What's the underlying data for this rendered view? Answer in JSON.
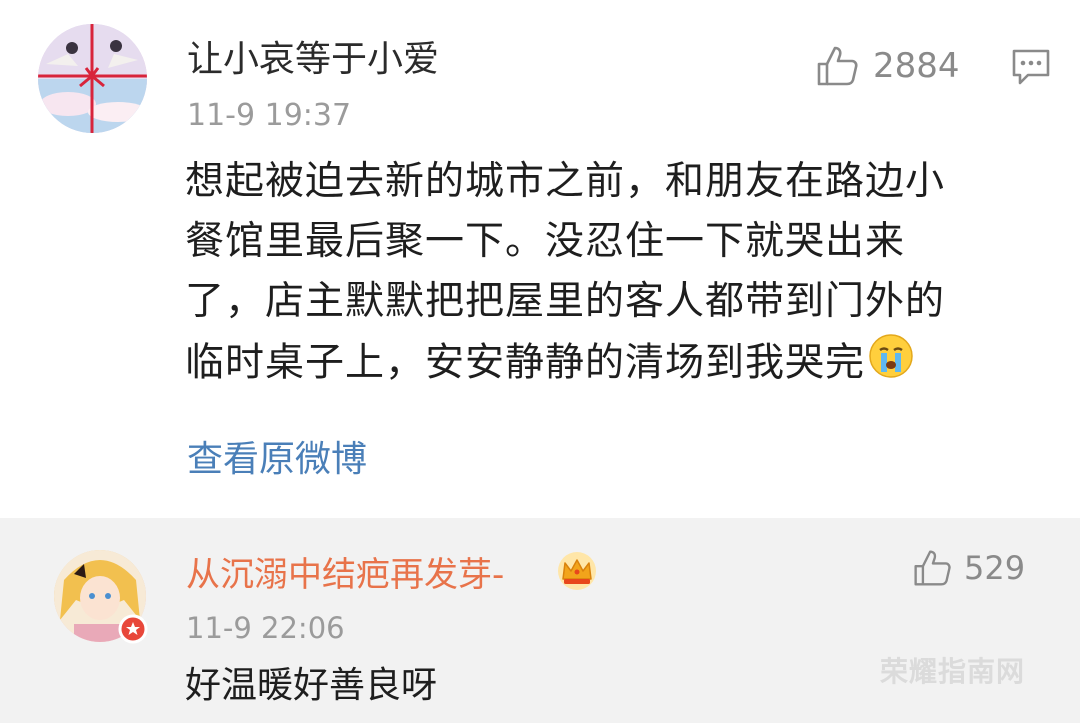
{
  "main_comment": {
    "username": "让小哀等于小爱",
    "timestamp": "11-9 19:37",
    "like_count": "2884",
    "body_lines": [
      "想起被迫去新的城市之前，和朋友在路边小",
      "餐馆里最后聚一下。没忍住一下就哭出来",
      "了，店主默默把把屋里的客人都带到门外的",
      "临时桌子上，安安静静的清场到我哭完"
    ],
    "view_original": "查看原微博"
  },
  "reply_comment": {
    "username": "从沉溺中结疤再发芽-",
    "timestamp": "11-9 22:06",
    "like_count": "529",
    "text": "好温暖好善良呀"
  },
  "watermark": "荣耀指南网",
  "icons": {
    "like": "thumbs-up-icon",
    "reply": "comment-bubble-icon",
    "emoji": "crying-face-icon",
    "crown": "crown-icon",
    "badge": "verified-badge-icon"
  },
  "colors": {
    "link": "#4a7fb8",
    "reply_username": "#e8734a",
    "meta_gray": "#9b9b9b",
    "reply_bg": "#f2f2f2"
  }
}
